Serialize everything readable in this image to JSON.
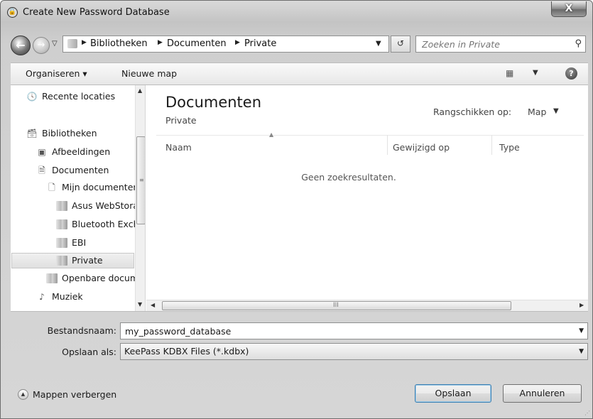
{
  "window": {
    "title": "Create New Password Database",
    "close_glyph": "X"
  },
  "navigation": {
    "back_glyph": "←",
    "forward_glyph": "→",
    "recent_glyph": "▽",
    "breadcrumbs": [
      "Bibliotheken",
      "Documenten",
      "Private"
    ],
    "search_placeholder": "Zoeken in Private"
  },
  "toolbar": {
    "organize_label": "Organiseren ▾",
    "new_folder_label": "Nieuwe map",
    "help_glyph": "?"
  },
  "nav_pane": {
    "items": [
      {
        "label": "Recente locaties",
        "icon": "recent-places-icon"
      },
      {
        "label": "Bibliotheken",
        "icon": "libraries-icon"
      },
      {
        "label": "Afbeeldingen",
        "icon": "pictures-icon"
      },
      {
        "label": "Documenten",
        "icon": "documents-icon"
      },
      {
        "label": "Mijn documenten",
        "icon": "document-icon"
      },
      {
        "label": "Asus WebStorage",
        "icon": "folder-icon"
      },
      {
        "label": "Bluetooth Exchange",
        "icon": "folder-icon"
      },
      {
        "label": "EBI",
        "icon": "folder-icon"
      },
      {
        "label": "Private",
        "icon": "folder-icon",
        "selected": true
      },
      {
        "label": "Openbare documenten",
        "icon": "folder-icon"
      },
      {
        "label": "Muziek",
        "icon": "music-icon"
      }
    ]
  },
  "content": {
    "library_title": "Documenten",
    "library_subtitle": "Private",
    "arrange_label": "Rangschikken op:",
    "arrange_value": "Map",
    "columns": [
      "Naam",
      "Gewijzigd op",
      "Type"
    ],
    "empty_message": "Geen zoekresultaten."
  },
  "form": {
    "filename_label": "Bestandsnaam:",
    "filename_value": "my_password_database",
    "filetype_label": "Opslaan als:",
    "filetype_value": "KeePass KDBX Files (*.kdbx)"
  },
  "footer": {
    "hide_folders_label": "Mappen verbergen",
    "save_label": "Opslaan",
    "cancel_label": "Annuleren"
  },
  "scroll_glyphs": {
    "up": "▲",
    "down": "▼",
    "left": "◀",
    "right": "▶",
    "grip_v": "≡",
    "grip_h": "III"
  }
}
